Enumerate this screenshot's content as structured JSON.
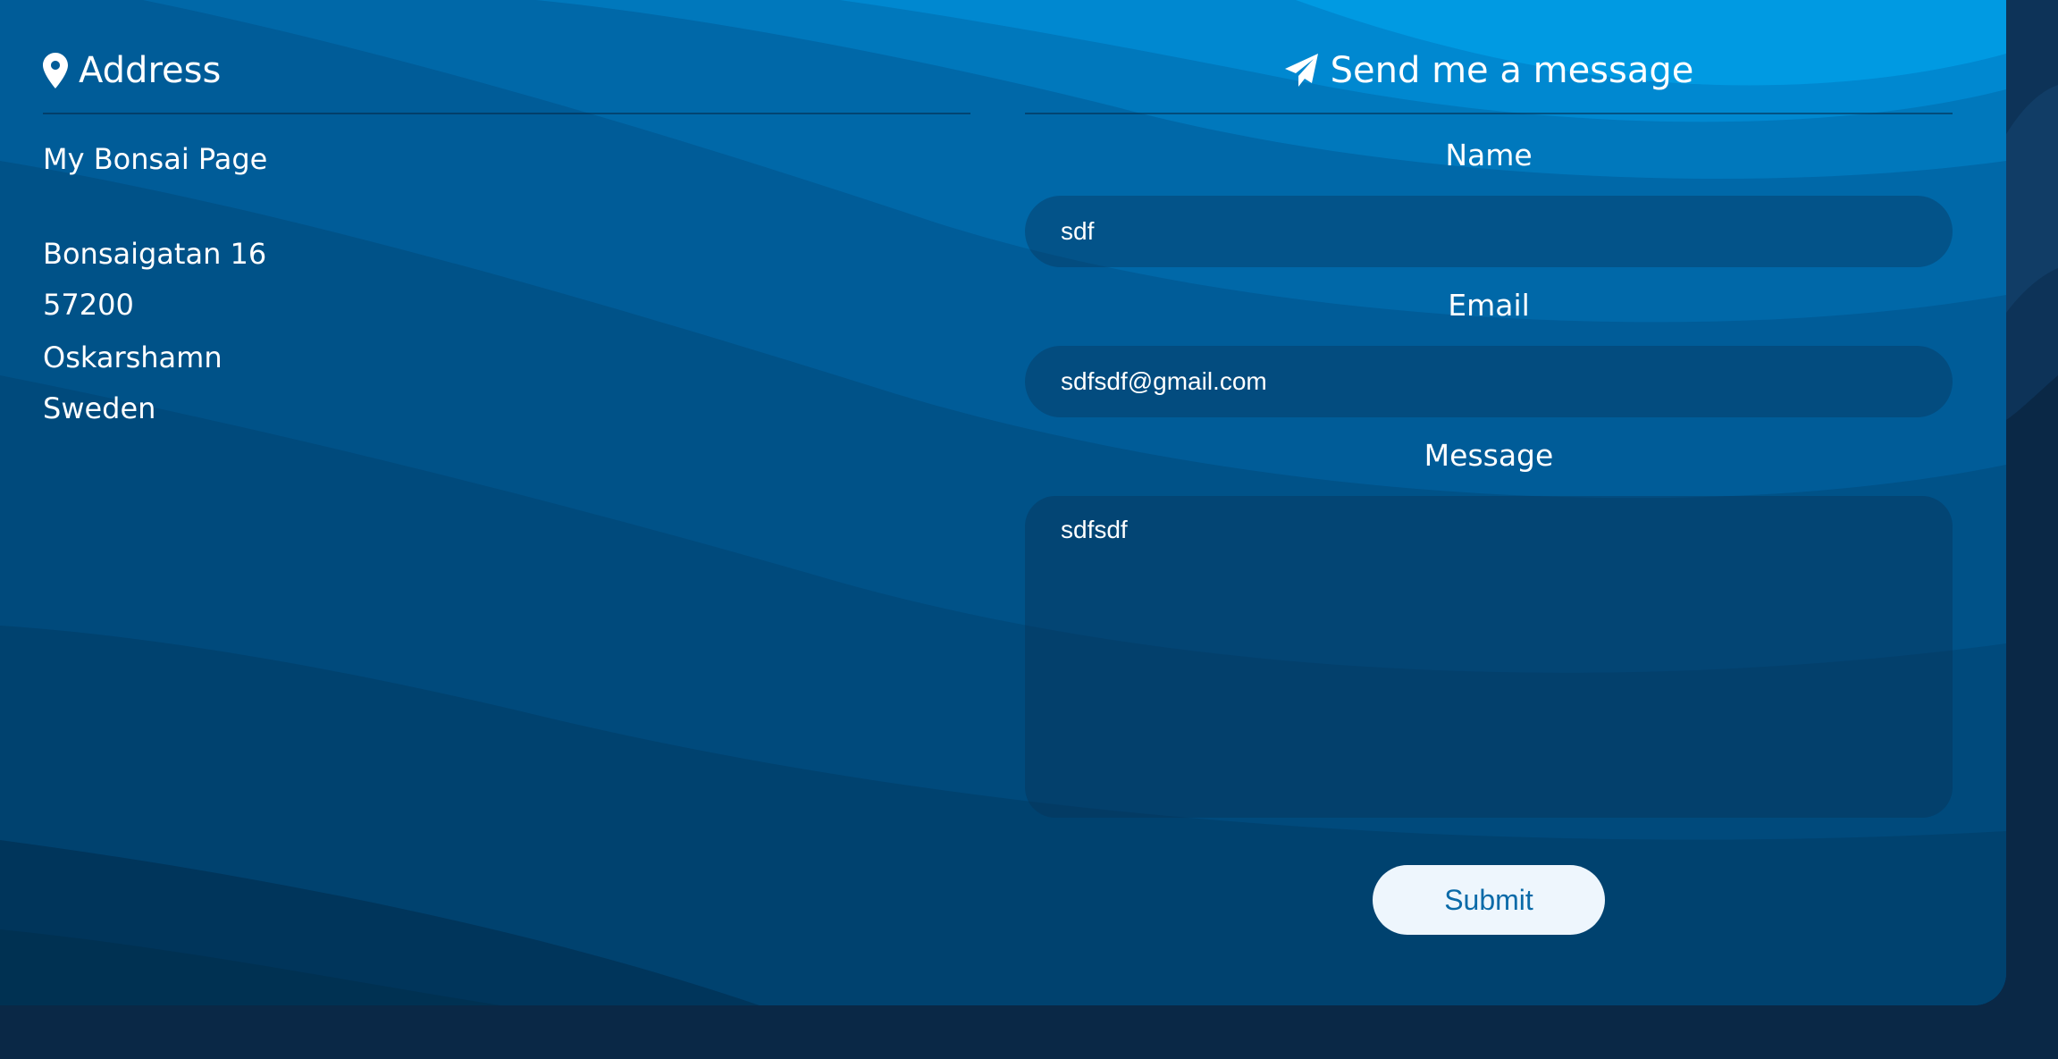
{
  "colors": {
    "accent_light": "#00a2e8",
    "card_mid": "#00548f",
    "card_dark": "#003358",
    "page_bg": "#0a2846",
    "button_bg": "#eef6fd",
    "button_text": "#0a6aa8"
  },
  "address": {
    "heading": "Address",
    "icon": "map-marker-icon",
    "lines": [
      "My Bonsai Page",
      "Bonsaigatan 16",
      "57200",
      "Oskarshamn",
      "Sweden"
    ]
  },
  "contact_form": {
    "heading": "Send me a message",
    "icon": "paper-plane-icon",
    "name_label": "Name",
    "name_value": "sdf",
    "email_label": "Email",
    "email_value": "sdfsdf@gmail.com",
    "message_label": "Message",
    "message_value": "sdfsdf",
    "submit_label": "Submit"
  }
}
